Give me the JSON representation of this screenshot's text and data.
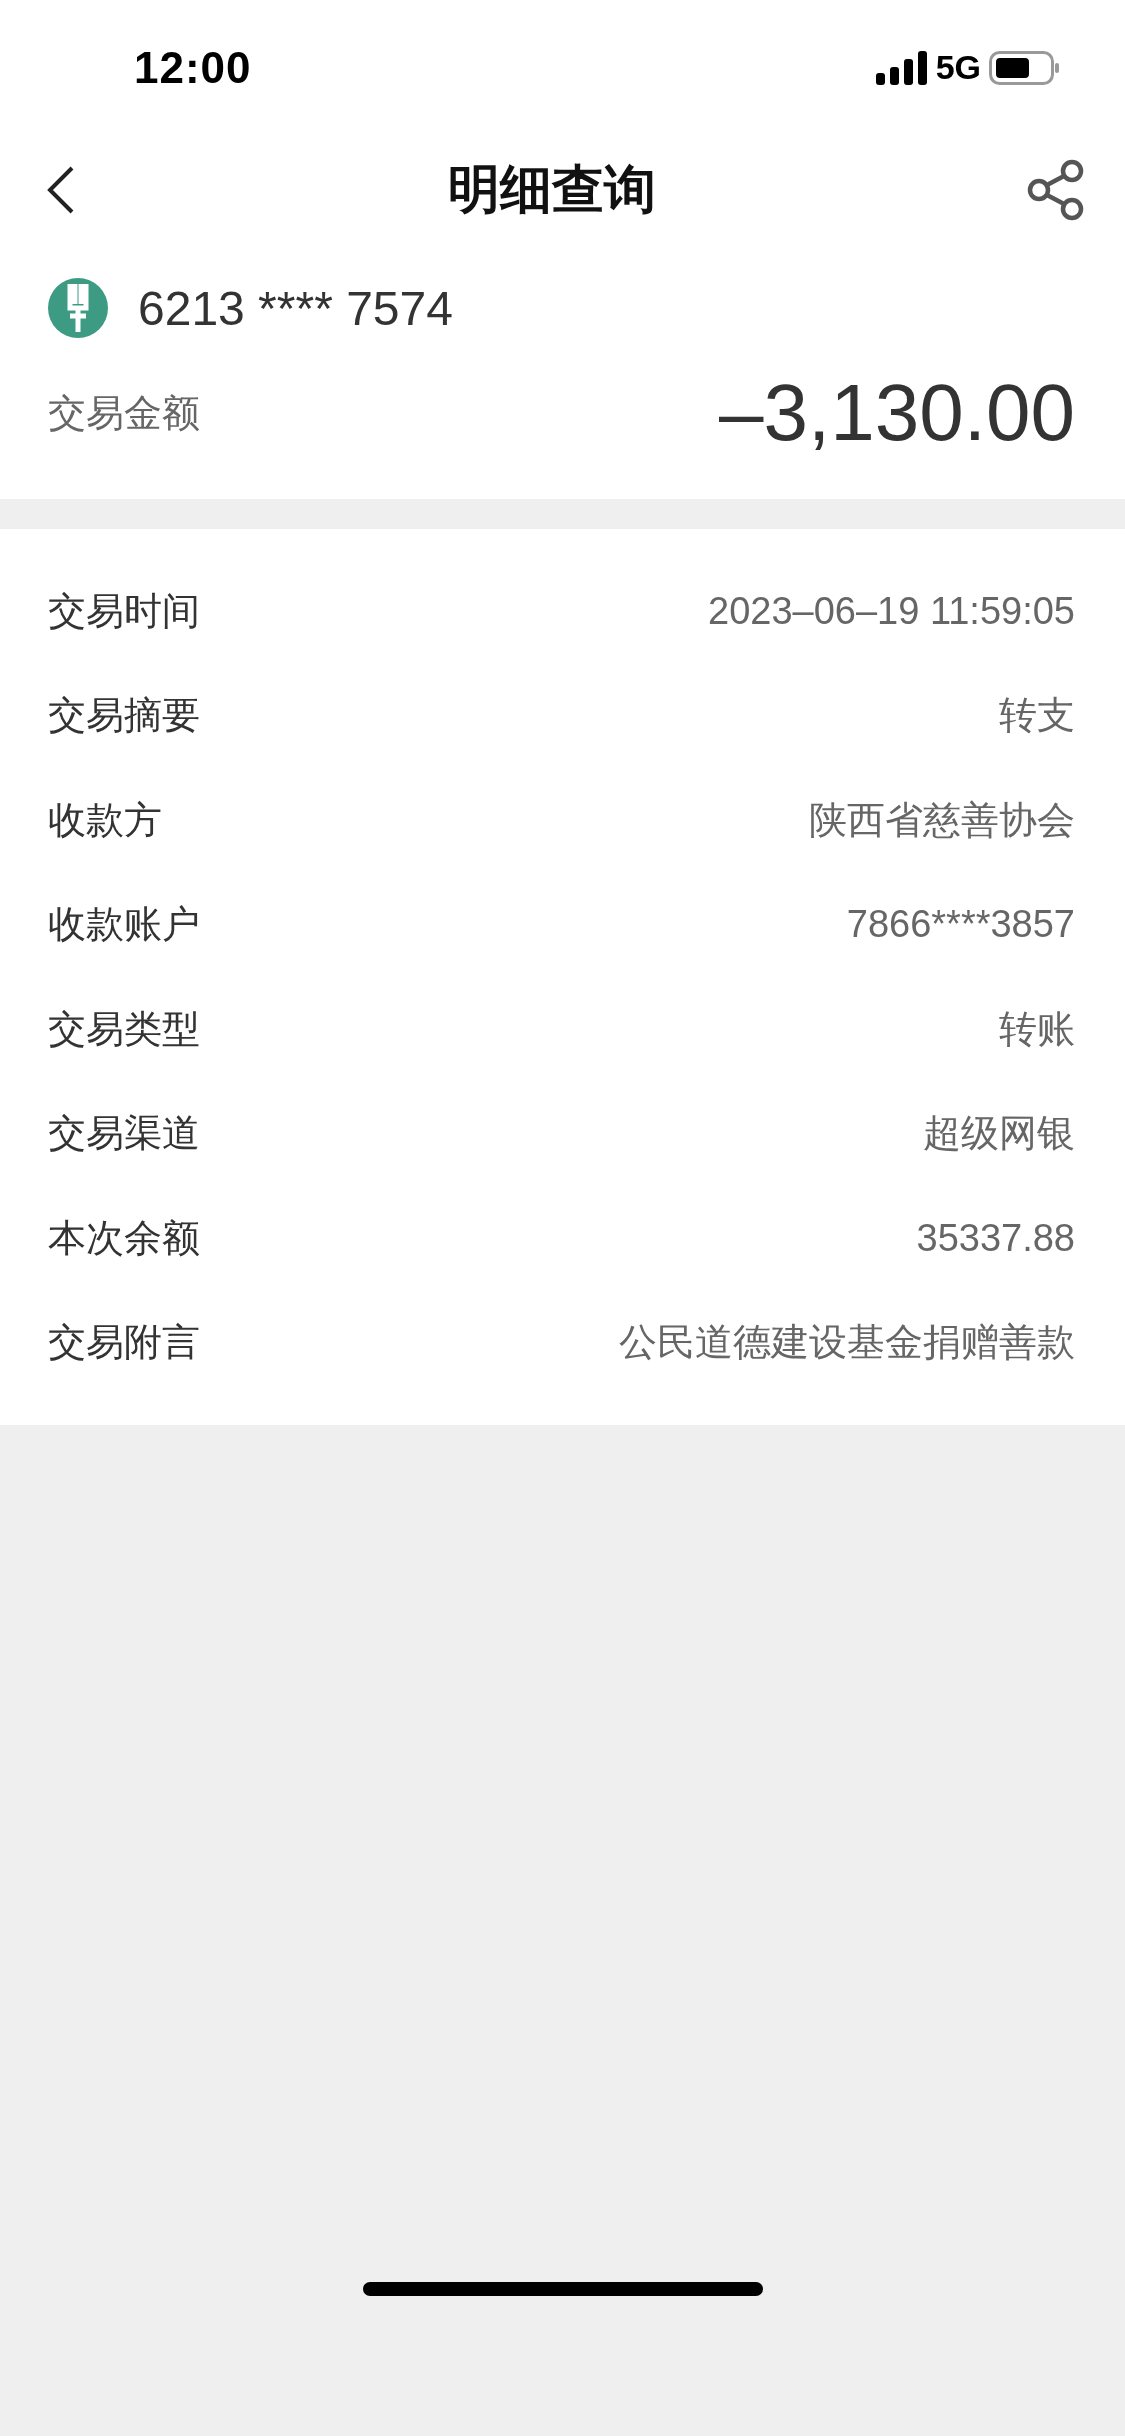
{
  "status_bar": {
    "time": "12:00",
    "network": "5G"
  },
  "header": {
    "title": "明细查询"
  },
  "account": {
    "card_number": "6213 **** 7574",
    "amount_label": "交易金额",
    "amount": "–3,130.00"
  },
  "details": [
    {
      "label": "交易时间",
      "value": "2023–06–19 11:59:05"
    },
    {
      "label": "交易摘要",
      "value": "转支"
    },
    {
      "label": "收款方",
      "value": "陕西省慈善协会"
    },
    {
      "label": "收款账户",
      "value": "7866****3857"
    },
    {
      "label": "交易类型",
      "value": "转账"
    },
    {
      "label": "交易渠道",
      "value": "超级网银"
    },
    {
      "label": "本次余额",
      "value": "35337.88"
    },
    {
      "label": "交易附言",
      "value": "公民道德建设基金捐赠善款"
    }
  ]
}
